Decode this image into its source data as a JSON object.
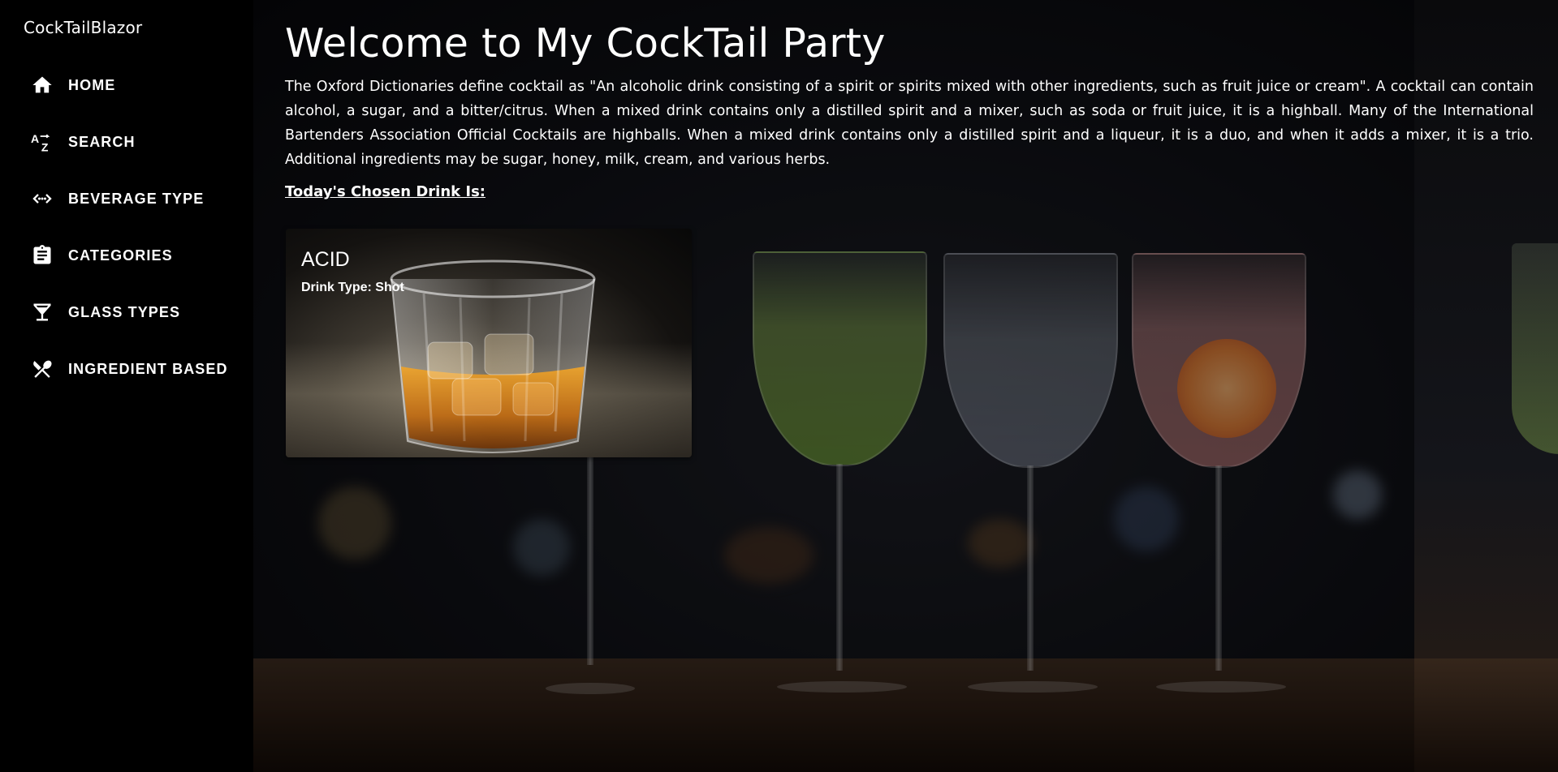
{
  "app": {
    "brand": "CockTailBlazor"
  },
  "sidebar": {
    "items": [
      {
        "label": "HOME",
        "icon": "home-icon"
      },
      {
        "label": "SEARCH",
        "icon": "sort-az-icon"
      },
      {
        "label": "BEVERAGE TYPE",
        "icon": "code-arrows-icon"
      },
      {
        "label": "CATEGORIES",
        "icon": "clipboard-icon"
      },
      {
        "label": "GLASS TYPES",
        "icon": "cocktail-glass-icon"
      },
      {
        "label": "INGREDIENT BASED",
        "icon": "utensils-icon"
      }
    ]
  },
  "main": {
    "title": "Welcome to My CockTail Party",
    "intro": "The Oxford Dictionaries define cocktail as \"An alcoholic drink consisting of a spirit or spirits mixed with other ingredients, such as fruit juice or cream\". A cocktail can contain alcohol, a sugar, and a bitter/citrus. When a mixed drink contains only a distilled spirit and a mixer, such as soda or fruit juice, it is a highball. Many of the International Bartenders Association Official Cocktails are highballs. When a mixed drink contains only a distilled spirit and a liqueur, it is a duo, and when it adds a mixer, it is a trio. Additional ingredients may be sugar, honey, milk, cream, and various herbs.",
    "chosen_heading": "Today's Chosen Drink Is:",
    "drink": {
      "name": "ACID",
      "type": "Drink Type: Shot"
    }
  },
  "colors": {
    "sidebar_bg": "#000000",
    "text": "#ffffff"
  }
}
